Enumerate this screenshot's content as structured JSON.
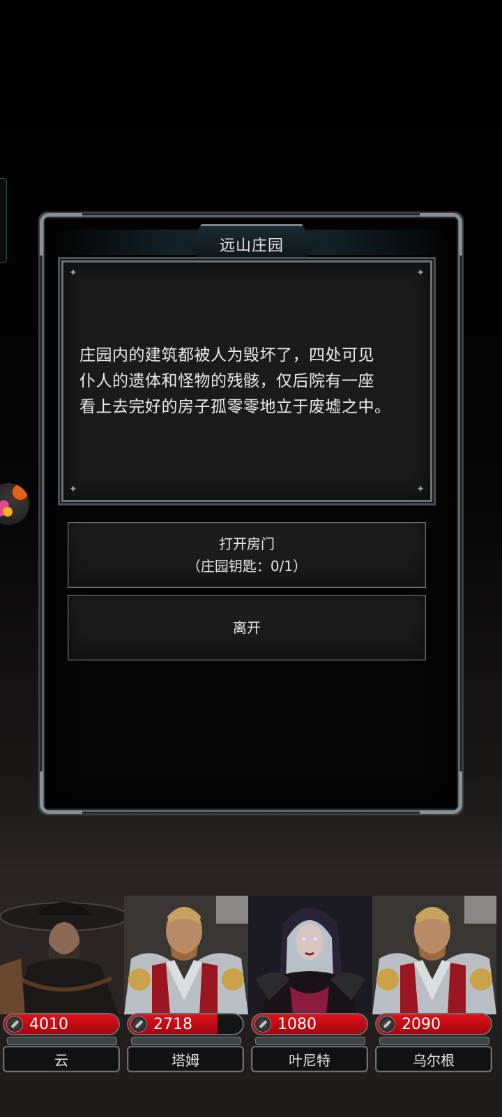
{
  "dialog": {
    "title": "远山庄园",
    "description_lines": [
      "庄园内的建筑都被人为毁坏了，四处可见",
      "仆人的遗体和怪物的残骸，仅后院有一座",
      "看上去完好的房子孤零零地立于废墟之中。"
    ],
    "options": [
      {
        "label": "打开房门",
        "requirement": "（庄园钥匙：0/1）"
      },
      {
        "label": "离开"
      }
    ]
  },
  "party": [
    {
      "name": "云",
      "hp": "4010",
      "hp_fill": 1.0
    },
    {
      "name": "塔姆",
      "hp": "2718",
      "hp_fill": 0.78
    },
    {
      "name": "叶尼特",
      "hp": "1080",
      "hp_fill": 1.0
    },
    {
      "name": "乌尔根",
      "hp": "2090",
      "hp_fill": 1.0
    }
  ],
  "colors": {
    "hp_red": "#d0101a",
    "frame_steel": "#6b7276"
  }
}
